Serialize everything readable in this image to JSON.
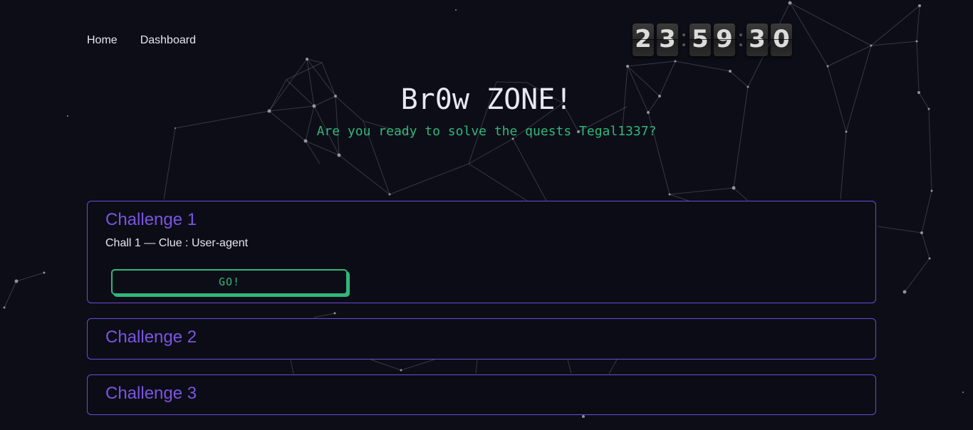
{
  "nav": {
    "items": [
      {
        "label": "Home"
      },
      {
        "label": "Dashboard"
      }
    ]
  },
  "countdown": {
    "hours": [
      "2",
      "3"
    ],
    "minutes": [
      "5",
      "9"
    ],
    "seconds": [
      "3",
      "0"
    ]
  },
  "hero": {
    "title": "Br0w ZONE!",
    "subtitle": "Are you ready to solve the quests Tegal1337?"
  },
  "challenges": [
    {
      "title": "Challenge 1",
      "clue": "Chall 1 — Clue : User-agent",
      "button_label": "GO!"
    },
    {
      "title": "Challenge 2"
    },
    {
      "title": "Challenge 3"
    }
  ],
  "colors": {
    "background": "#0d0d17",
    "accent_purple": "#6a4bd6",
    "accent_green": "#2fb87a"
  }
}
